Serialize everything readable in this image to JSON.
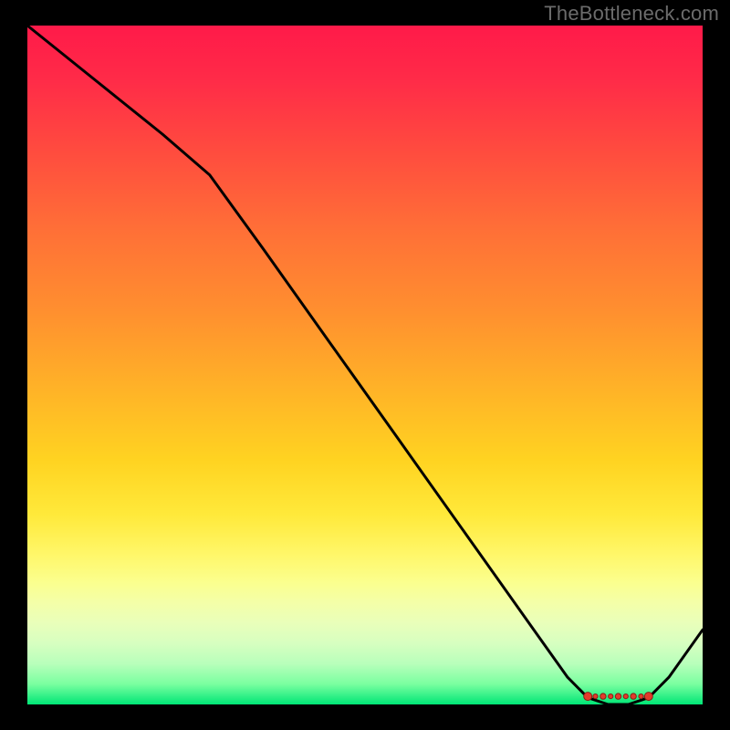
{
  "watermark": "TheBottleneck.com",
  "colors": {
    "background_black": "#000000",
    "watermark_gray": "#6b6b6b",
    "gradient_top": "#ff1a49",
    "gradient_mid": "#ffd321",
    "gradient_bottom": "#00e676",
    "curve": "#000000",
    "spot_fill": "#e33b2b",
    "spot_stroke": "#8a1f15"
  },
  "chart_data": {
    "type": "line",
    "title": "",
    "xlabel": "",
    "ylabel": "",
    "xlim": [
      0,
      100
    ],
    "ylim": [
      0,
      100
    ],
    "x": [
      0,
      10,
      20,
      27,
      35,
      45,
      55,
      65,
      75,
      80,
      83,
      86,
      89,
      92,
      95,
      100
    ],
    "values": [
      100,
      92,
      84,
      78,
      67,
      53,
      39,
      25,
      11,
      4,
      1,
      0,
      0,
      1,
      4,
      11
    ],
    "min_region_x": [
      83,
      92
    ],
    "annotations": []
  }
}
